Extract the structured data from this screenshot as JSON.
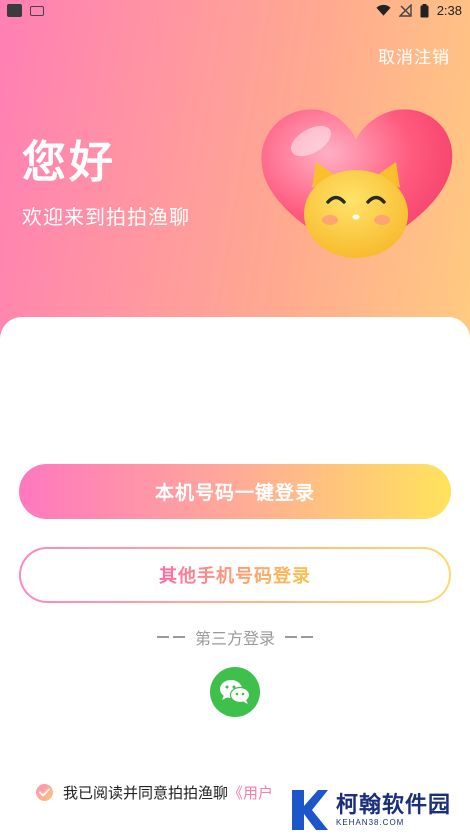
{
  "status_bar": {
    "time": "2:38",
    "icons": [
      "app-icon",
      "app-icon-2",
      "wifi-icon",
      "no-signal-icon",
      "battery-icon"
    ]
  },
  "header": {
    "cancel_label": "取消注销",
    "title": "您好",
    "subtitle": "欢迎来到拍拍渔聊",
    "mascot_icon": "heart-cat-mascot-icon"
  },
  "actions": {
    "primary_label": "本机号码一键登录",
    "secondary_label": "其他手机号码登录"
  },
  "third_party": {
    "label": "第三方登录",
    "wechat_icon": "wechat-icon"
  },
  "agreement": {
    "prefix": "我已阅读并同意拍拍渔聊",
    "link": "《用户",
    "checked": true
  },
  "watermark": {
    "name": "柯翰软件园",
    "url": "KEHAN38.COM"
  },
  "colors": {
    "gradient_pink": "#ff7fb4",
    "gradient_yellow": "#ffd97a",
    "wechat_green": "#3fbf4b",
    "link_pink": "#ff7aa8"
  }
}
